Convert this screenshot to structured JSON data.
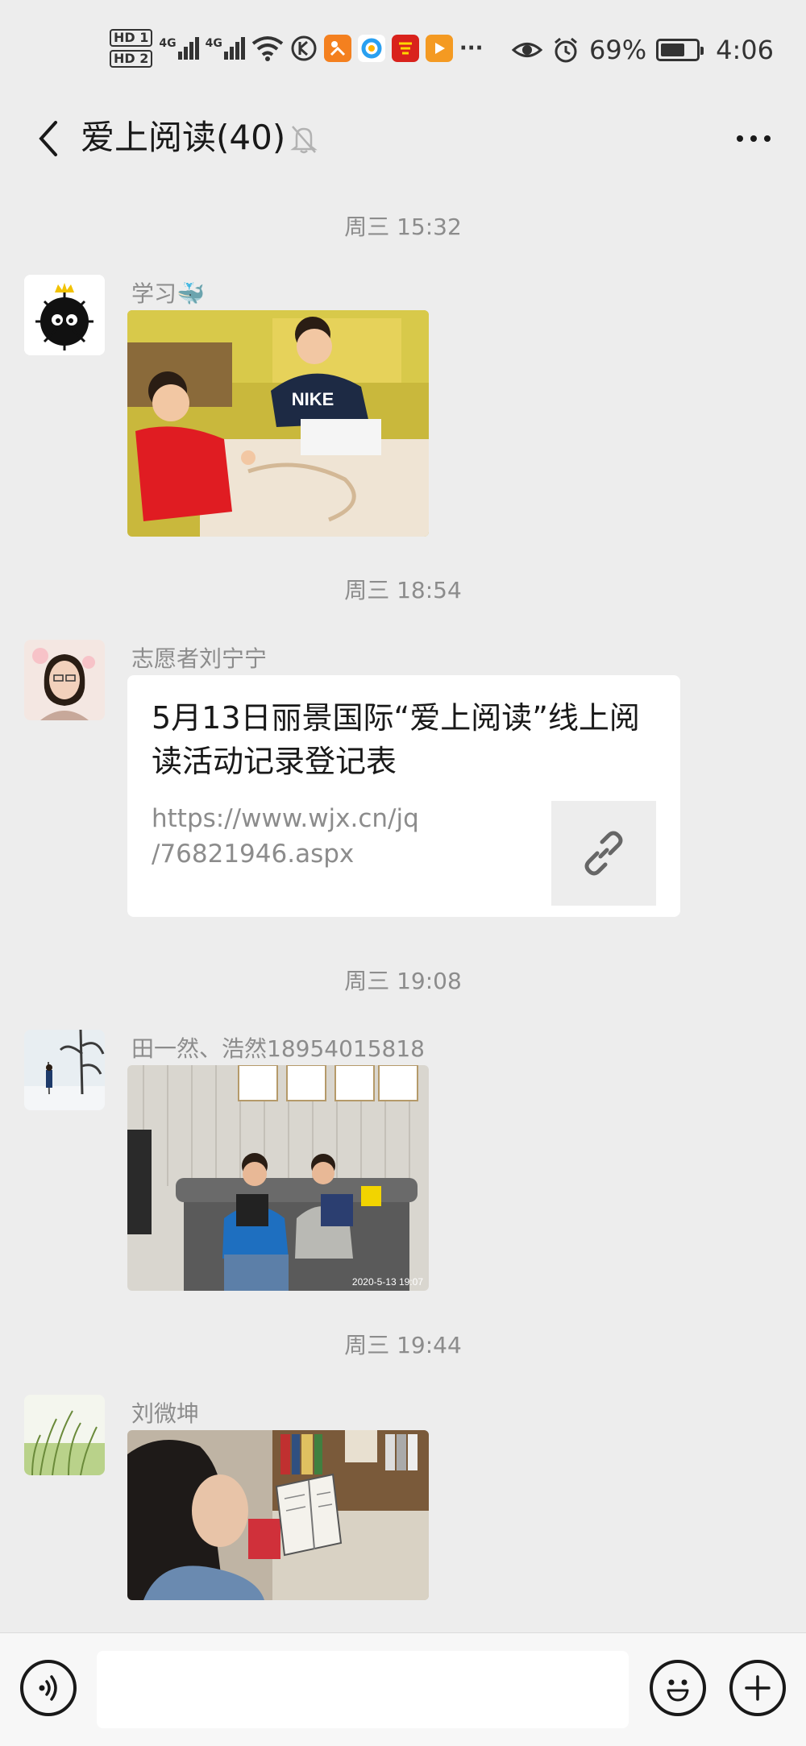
{
  "status_bar": {
    "hd1": "HD 1",
    "hd2": "HD 2",
    "signal_label_1": "4G",
    "signal_label_2": "4G",
    "battery_percent": "69%",
    "battery_level": 0.69,
    "time": "4:06",
    "overflow": "···",
    "icons": [
      "wifi-icon",
      "k-app-icon",
      "orange-app-icon",
      "blue-app-icon",
      "red-app-icon",
      "video-app-icon",
      "eye-icon",
      "alarm-icon"
    ]
  },
  "header": {
    "title": "爱上阅读(40)"
  },
  "messages": [
    {
      "time": "周三 15:32",
      "sender": "学习🐳",
      "type": "image"
    },
    {
      "time": "周三 18:54",
      "sender": "志愿者刘宁宁",
      "type": "link",
      "link_title": "5月13日丽景国际“爱上阅读”线上阅读活动记录登记表",
      "link_url_line1": "https://www.wjx.cn/jq",
      "link_url_line2": "/76821946.aspx"
    },
    {
      "time": "周三 19:08",
      "sender": "田一然、浩然18954015818",
      "type": "image",
      "photo_stamp": "2020-5-13 19:07"
    },
    {
      "time": "周三 19:44",
      "sender": "刘微坤",
      "type": "image"
    }
  ],
  "input": {
    "placeholder": ""
  },
  "colors": {
    "background": "#ededed",
    "bubble": "#ffffff",
    "secondary_text": "#8c8c8c"
  }
}
